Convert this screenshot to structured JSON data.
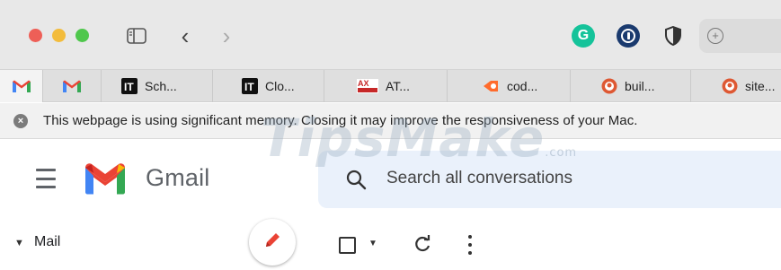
{
  "window": {
    "traffic_lights": {
      "close": "#ee5f57",
      "minimize": "#f3bc3c",
      "zoom": "#4fc74c"
    },
    "toolbar": {
      "sidebar_icon": "sidebar-toggle-icon",
      "back_icon": "chevron-left-icon",
      "forward_icon": "chevron-right-icon",
      "back_glyph": "‹",
      "forward_glyph": "›"
    },
    "extensions": [
      {
        "name": "grammarly-icon",
        "glyph": "G",
        "color": "#15c39a"
      },
      {
        "name": "1password-icon",
        "color": "#1a3a6e"
      },
      {
        "name": "shield-icon",
        "color": "#333333"
      }
    ],
    "address_bar_icon": "plus-icon"
  },
  "tabs": [
    {
      "icon": "gmail-icon",
      "label": ""
    },
    {
      "icon": "gmail-icon",
      "label": ""
    },
    {
      "icon": "it-icon",
      "label": "Sch..."
    },
    {
      "icon": "it-icon",
      "label": "Clo..."
    },
    {
      "icon": "at-icon",
      "label": "AT..."
    },
    {
      "icon": "code-icon",
      "label": "cod..."
    },
    {
      "icon": "duckduckgo-icon",
      "label": "buil..."
    },
    {
      "icon": "duckduckgo-icon",
      "label": "site..."
    }
  ],
  "banner": {
    "icon": "close-circle-icon",
    "text": "This webpage is using significant memory. Closing it may improve the responsiveness of your Mac."
  },
  "gmail": {
    "menu_icon": "hamburger-menu-icon",
    "brand": "Gmail",
    "search": {
      "placeholder": "Search all conversations",
      "value": ""
    },
    "nav": {
      "section_label": "Mail"
    },
    "compose_icon": "pencil-icon",
    "toolbar_icons": [
      "checkbox-icon",
      "chevron-down-icon",
      "refresh-icon",
      "more-vertical-icon"
    ]
  },
  "watermark": {
    "text": "TipsMake",
    "suffix": ".com"
  },
  "colors": {
    "gmail_red": "#ea4335",
    "gmail_blue": "#4285f4",
    "gmail_green": "#34a853",
    "gmail_yellow": "#fbbc04",
    "search_bg": "#eaf1fb"
  }
}
